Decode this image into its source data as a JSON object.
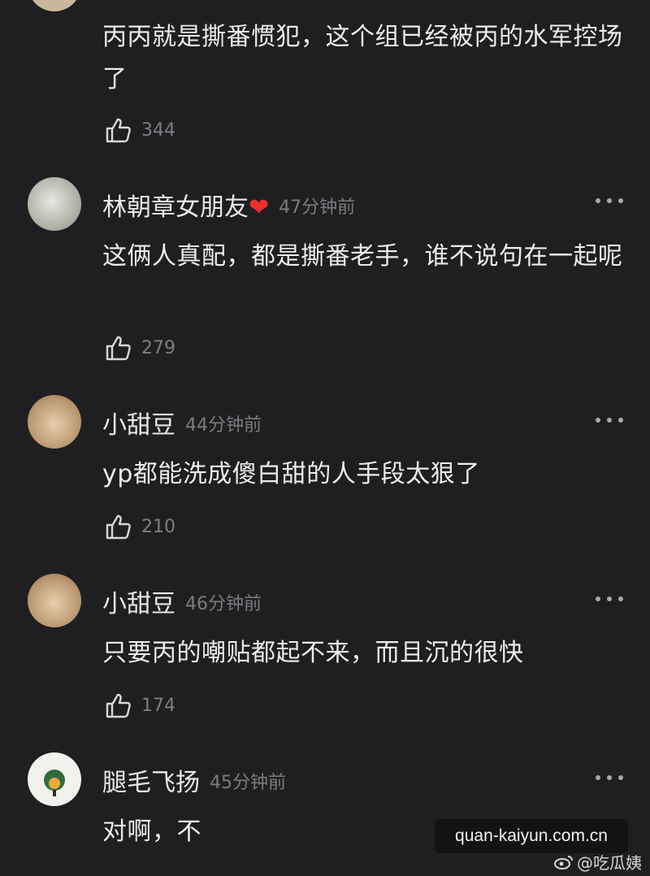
{
  "comments": [
    {
      "text": "丙丙就是撕番惯犯，这个组已经被丙的水军控场了",
      "likes": "344"
    },
    {
      "username": "林朝章女朋友",
      "heart": "❤",
      "time": "47分钟前",
      "text": "这俩人真配，都是撕番老手，谁不说句在一起呢",
      "likes": "279"
    },
    {
      "username": "小甜豆",
      "time": "44分钟前",
      "text": "yp都能洗成傻白甜的人手段太狠了",
      "likes": "210"
    },
    {
      "username": "小甜豆",
      "time": "46分钟前",
      "text": "只要丙的嘲贴都起不来，而且沉的很快",
      "likes": "174"
    },
    {
      "username": "腿毛飞扬",
      "time": "45分钟前",
      "text": "对啊，不"
    }
  ],
  "watermark": "quan-kaiyun.com.cn",
  "weibo_handle": "@吃瓜姨",
  "colors": {
    "background": "#1f1f21",
    "text": "#ececee",
    "meta": "#7c7c80",
    "heart": "#ef2f2f"
  },
  "icons": {
    "like": "thumbs-up-icon",
    "more": "more-dots-icon",
    "weibo": "weibo-logo-icon"
  }
}
